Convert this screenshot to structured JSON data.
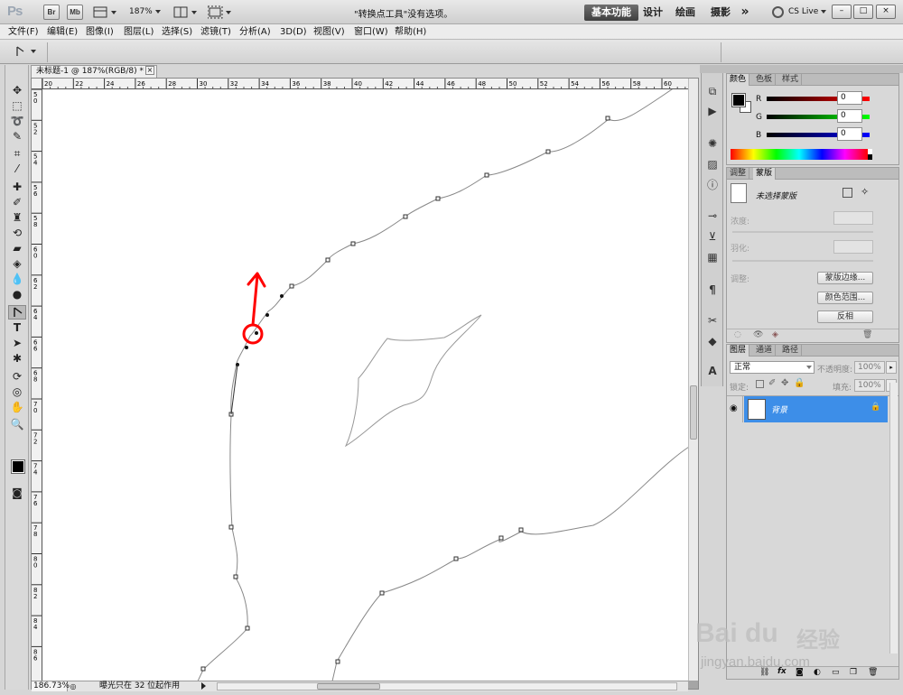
{
  "app": {
    "logo": "Ps",
    "bridge_label": "Br",
    "minibridge_label": "Mb",
    "zoom": "187%",
    "workspaces": [
      "基本功能",
      "设计",
      "绘画",
      "摄影"
    ],
    "more": "»",
    "cs_live": "CS Live",
    "window_buttons": [
      "–",
      "□",
      "×"
    ]
  },
  "menu": [
    "文件(F)",
    "编辑(E)",
    "图像(I)",
    "图层(L)",
    "选择(S)",
    "滤镜(T)",
    "分析(A)",
    "3D(D)",
    "视图(V)",
    "窗口(W)",
    "帮助(H)"
  ],
  "options": {
    "message": "\"转换点工具\"没有选项。"
  },
  "document": {
    "tab_title": "未标题-1 @ 187%(RGB/8) *",
    "ruler_h": [
      "20",
      "22",
      "24",
      "26",
      "28",
      "30",
      "32",
      "34",
      "36",
      "38",
      "40",
      "42",
      "44",
      "46",
      "48",
      "50",
      "52",
      "54",
      "56",
      "58",
      "60"
    ],
    "ruler_v": [
      "50",
      "52",
      "54",
      "56",
      "58",
      "60",
      "62",
      "64",
      "66",
      "68",
      "70",
      "72",
      "74",
      "76",
      "78",
      "80",
      "82",
      "84",
      "86"
    ],
    "status_zoom": "186.73%",
    "status_message": "曝光只在 32 位起作用"
  },
  "color_panel": {
    "tabs": [
      "颜色",
      "色板",
      "样式"
    ],
    "channels": [
      {
        "label": "R",
        "value": "0",
        "color": "#e00000"
      },
      {
        "label": "G",
        "value": "0",
        "color": "#00b000"
      },
      {
        "label": "B",
        "value": "0",
        "color": "#0000e0"
      }
    ]
  },
  "adjust_panel": {
    "tabs": [
      "调整",
      "蒙版"
    ],
    "no_mask": "未选择蒙版",
    "density": "浓度:",
    "feather": "羽化:",
    "refine": "调整:",
    "buttons": [
      "蒙版边缘...",
      "颜色范围...",
      "反相"
    ]
  },
  "layers_panel": {
    "tabs": [
      "图层",
      "通道",
      "路径"
    ],
    "blend_mode": "正常",
    "opacity_label": "不透明度:",
    "opacity_value": "100%",
    "lock_label": "锁定:",
    "fill_label": "填充:",
    "fill_value": "100%",
    "layers": [
      {
        "name": "背景",
        "selected": true
      }
    ],
    "bottom_icons": [
      "link-icon",
      "fx-icon",
      "mask-icon",
      "adjustment-icon",
      "folder-icon",
      "new-layer-icon",
      "trash-icon"
    ]
  },
  "watermark": {
    "brand": "Bai du",
    "cn": "经验",
    "url": "jingyan.baidu.com"
  },
  "colors": {
    "accent_red": "#ff0000",
    "layer_selected": "#3d8ee8",
    "workspace_active": "#4a4a4a"
  }
}
